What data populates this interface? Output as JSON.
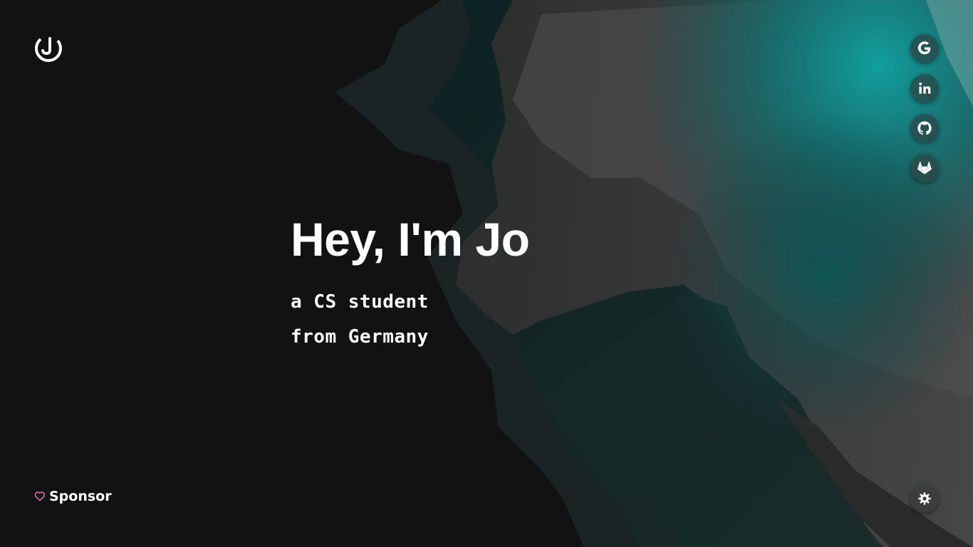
{
  "colors": {
    "background": "#121212",
    "text": "#ffffff",
    "accent_teal": "#0d8c8c",
    "heart": "#f06fb3"
  },
  "header": {
    "logo_icon": "jo-logo-icon"
  },
  "hero": {
    "title": "Hey, I'm Jo",
    "subtitle_line1": "a CS student",
    "subtitle_line2": "from Germany"
  },
  "social": [
    {
      "name": "google",
      "icon": "google-icon"
    },
    {
      "name": "linkedin",
      "icon": "linkedin-icon"
    },
    {
      "name": "github",
      "icon": "github-icon"
    },
    {
      "name": "gitlab",
      "icon": "gitlab-icon"
    }
  ],
  "footer": {
    "sponsor_label": "Sponsor",
    "sponsor_icon": "heart-icon",
    "theme_icon": "settings-gear-icon"
  }
}
